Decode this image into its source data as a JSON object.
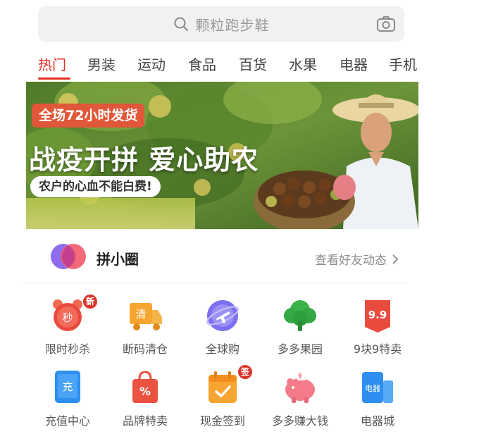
{
  "search": {
    "placeholder": "颗粒跑步鞋"
  },
  "tabs": [
    {
      "label": "热门",
      "active": true
    },
    {
      "label": "男装",
      "active": false
    },
    {
      "label": "运动",
      "active": false
    },
    {
      "label": "食品",
      "active": false
    },
    {
      "label": "百货",
      "active": false
    },
    {
      "label": "水果",
      "active": false
    },
    {
      "label": "电器",
      "active": false
    },
    {
      "label": "手机",
      "active": false
    }
  ],
  "banner": {
    "badge": "全场72小时发货",
    "headline": "战疫开拼 爱心助农",
    "pill": "农户的心血不能白费!"
  },
  "pinxiaoquan": {
    "title": "拼小圈",
    "link": "查看好友动态"
  },
  "grid": {
    "row1": [
      {
        "label": "限时秒杀",
        "icon": "alarm-clock-icon",
        "icon_text": "秒",
        "badge": "新"
      },
      {
        "label": "断码清仓",
        "icon": "delivery-truck-icon",
        "icon_text": "清"
      },
      {
        "label": "全球购",
        "icon": "globe-plane-icon"
      },
      {
        "label": "多多果园",
        "icon": "tree-icon"
      },
      {
        "label": "9块9特卖",
        "icon": "price-tag-icon",
        "icon_text": "9.9"
      }
    ],
    "row2": [
      {
        "label": "充值中心",
        "icon": "phone-recharge-icon",
        "icon_text": "充"
      },
      {
        "label": "品牌特卖",
        "icon": "shopping-bag-icon",
        "icon_text": "%"
      },
      {
        "label": "现金签到",
        "icon": "calendar-check-icon",
        "badge": "签"
      },
      {
        "label": "多多赚大钱",
        "icon": "piggy-bank-icon"
      },
      {
        "label": "电器城",
        "icon": "appliance-icon",
        "icon_text": "电器"
      }
    ]
  },
  "colors": {
    "accent": "#e02e24",
    "search_bg": "#f1f1f1",
    "muted_text": "#9a9a9a"
  }
}
